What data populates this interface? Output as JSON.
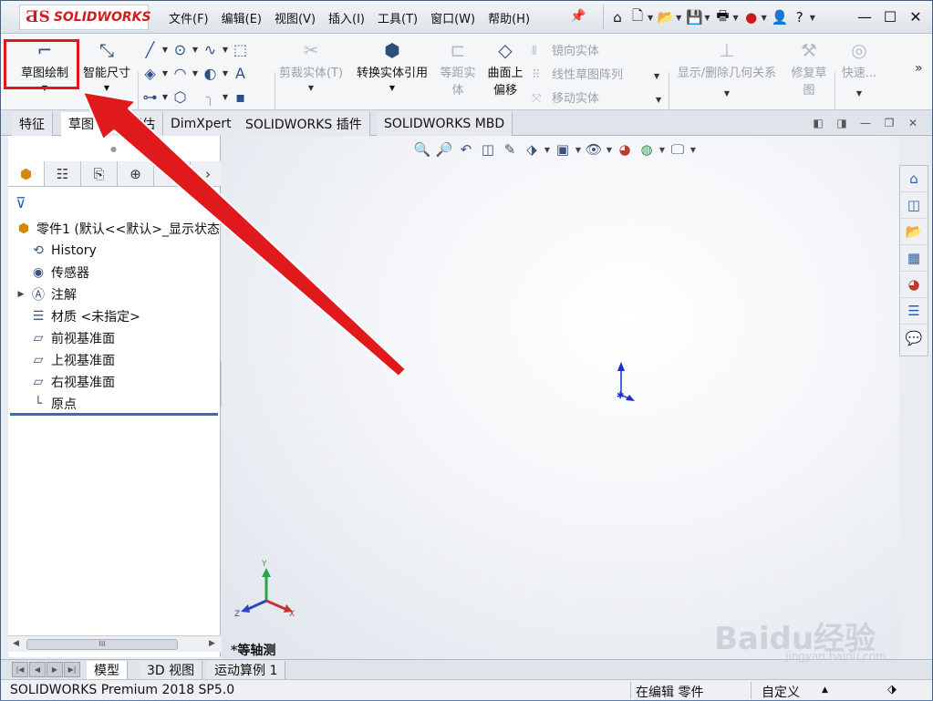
{
  "app": {
    "brand": "SOLIDWORKS",
    "accent": "#d11d1d"
  },
  "menu": [
    "文件(F)",
    "编辑(E)",
    "视图(V)",
    "插入(I)",
    "工具(T)",
    "窗口(W)",
    "帮助(H)"
  ],
  "quick_icons": [
    "home-icon",
    "new-file-icon",
    "open-icon",
    "save-icon",
    "print-icon",
    "rebuild-icon",
    "user-icon",
    "help-icon"
  ],
  "help_glyph": "?",
  "commands": {
    "sketch": "草图绘制",
    "smart_dimension": "智能尺寸",
    "trim": "剪裁实体(T)",
    "convert": "转换实体引用",
    "offset_l1": "等距实",
    "offset_l2": "体",
    "surface_offset_l1": "曲面上",
    "surface_offset_l2": "偏移",
    "mirror": "镜向实体",
    "linear_pattern": "线性草图阵列",
    "move": "移动实体",
    "relations": "显示/删除几何关系",
    "repair_l1": "修复草",
    "repair_l2": "图",
    "rapid": "快速..."
  },
  "tabs": [
    "特征",
    "草图",
    "评估",
    "DimXpert",
    "SOLIDWORKS 插件",
    "SOLIDWORKS MBD"
  ],
  "active_tab": "草图",
  "panel_tabs": [
    "feature-manager-icon",
    "property-manager-icon",
    "configuration-manager-icon",
    "dimxpert-manager-icon",
    "display-manager-icon"
  ],
  "tree": {
    "root": "零件1 (默认<<默认>_显示状态",
    "items": [
      {
        "label": "History",
        "icon": "history-icon",
        "expandable": false
      },
      {
        "label": "传感器",
        "icon": "sensor-icon",
        "expandable": false
      },
      {
        "label": "注解",
        "icon": "annotation-icon",
        "expandable": true
      },
      {
        "label": "材质 <未指定>",
        "icon": "material-icon",
        "expandable": false
      },
      {
        "label": "前视基准面",
        "icon": "plane-icon",
        "expandable": false
      },
      {
        "label": "上视基准面",
        "icon": "plane-icon",
        "expandable": false
      },
      {
        "label": "右视基准面",
        "icon": "plane-icon",
        "expandable": false
      },
      {
        "label": "原点",
        "icon": "origin-icon",
        "expandable": false
      }
    ]
  },
  "hscroll_thumb": "III",
  "view_label": "*等轴测",
  "triad": {
    "x": "X",
    "y": "Y",
    "z": "Z"
  },
  "bottom_tabs": [
    "模型",
    "3D 视图",
    "运动算例 1"
  ],
  "status": {
    "product": "SOLIDWORKS Premium 2018 SP5.0",
    "mode": "在编辑 零件",
    "custom": "自定义"
  },
  "watermark": {
    "main": "Baidu经验",
    "sub": "jingyan.baidu.com"
  },
  "annotation": {
    "highlight_color": "#e0191c",
    "arrow_color": "#e0191c"
  }
}
